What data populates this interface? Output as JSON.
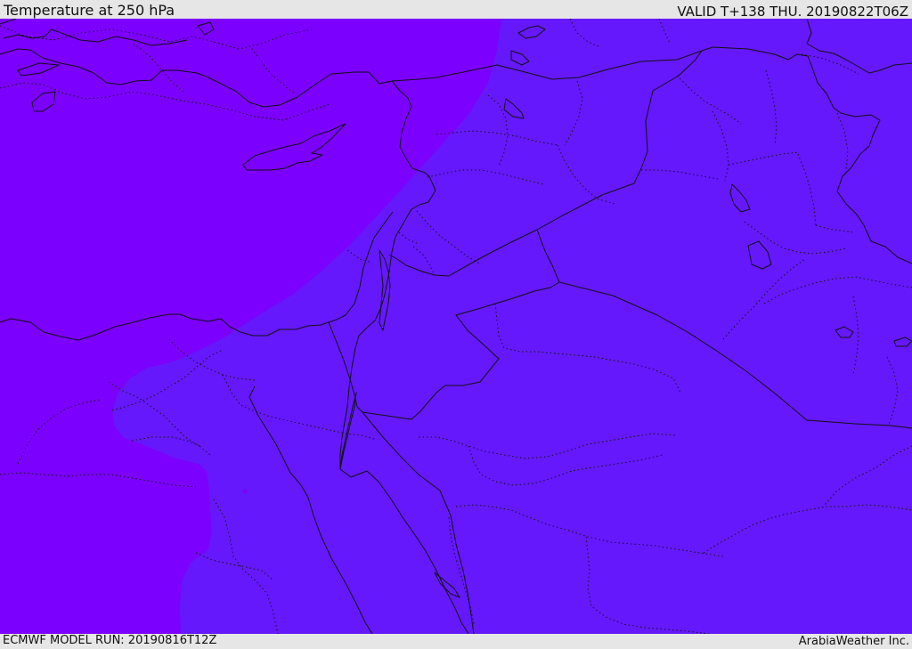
{
  "header": {
    "title": "Temperature at 250 hPa",
    "valid_time": "VALID T+138 THU. 20190822T06Z"
  },
  "footer": {
    "model_run": "ECMWF MODEL RUN: 20190816T12Z",
    "credit": "ArabiaWeather Inc."
  },
  "map": {
    "colors": {
      "cool_band": "#7c00fd",
      "warm_band": "#6518fc",
      "boundaries": "#111111"
    }
  }
}
